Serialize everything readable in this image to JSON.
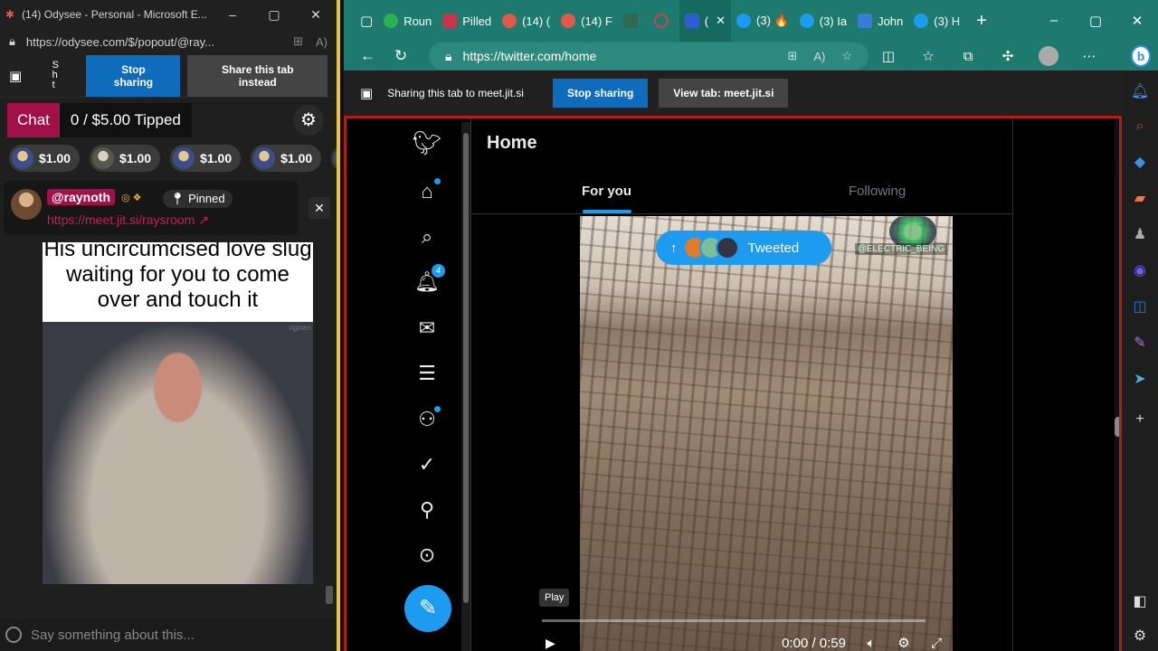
{
  "left_window": {
    "title": "(14) Odysee - Personal - Microsoft E...",
    "url": "https://odysee.com/$/popout/@ray...",
    "share_bar": {
      "vertical_text": "S h t",
      "stop_sharing": "Stop sharing",
      "share_instead": "Share this tab instead"
    },
    "chat": {
      "tab_label": "Chat",
      "tip_total": "0 / $5.00 Tipped"
    },
    "tips": [
      "$1.00",
      "$1.00",
      "$1.00",
      "$1.00"
    ],
    "pinned": {
      "username": "@raynoth",
      "pinned_label": "Pinned",
      "link": "https://meet.jit.si/raysroom"
    },
    "meme_caption": "His uncircumcised love slug waiting for you to come over and touch it",
    "meme_watermark": "rigmen",
    "chat_input_placeholder": "Say something about this..."
  },
  "right_window": {
    "tabs": [
      {
        "label": "Roun",
        "color": "#2ab34a"
      },
      {
        "label": "Pilled",
        "color": "#c8354a"
      },
      {
        "label": "(14) (",
        "color": "#e05a4a"
      },
      {
        "label": "(14) F",
        "color": "#e05a4a"
      },
      {
        "label": "",
        "color": "#2d6a4f"
      },
      {
        "label": "",
        "color": "#c44"
      },
      {
        "label": "(",
        "color": "#2f5bd3"
      },
      {
        "label": "(3) 🔥",
        "color": "#1d9bf0"
      },
      {
        "label": "(3) Ia",
        "color": "#1d9bf0"
      },
      {
        "label": "John",
        "color": "#3a7ad9"
      },
      {
        "label": "(3) H",
        "color": "#1d9bf0"
      }
    ],
    "url": "https://twitter.com/home",
    "share_bar": {
      "text": "Sharing this tab to meet.jit.si",
      "stop_sharing": "Stop sharing",
      "view_tab": "View tab: meet.jit.si"
    }
  },
  "twitter": {
    "page_title": "Home",
    "tabs": [
      "For you",
      "Following"
    ],
    "notification_count": "4",
    "tweeted_pill": "Tweeted",
    "watermark": "@ELECTRIC_BEING",
    "play_tooltip": "Play",
    "video_time": "0:00 / 0:59"
  }
}
